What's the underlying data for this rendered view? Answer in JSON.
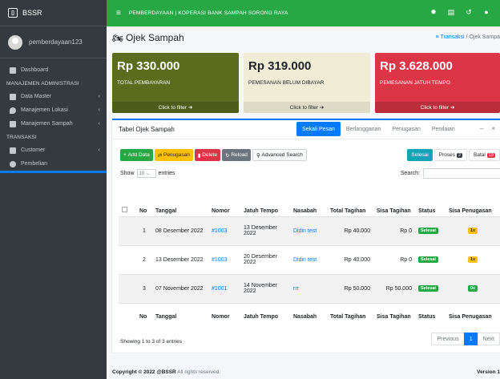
{
  "brand": {
    "name": "BSSR"
  },
  "user": {
    "name": "pemberdayaan123"
  },
  "sidebar": {
    "items": [
      {
        "label": "Dashboard"
      },
      {
        "header": "MANAJEMEN ADMINISTRASI"
      },
      {
        "label": "Data Master"
      },
      {
        "label": "Manajemen Lokasi"
      },
      {
        "label": "Manajemen Sampah"
      },
      {
        "header": "TRANSAKSI"
      },
      {
        "label": "Customer"
      },
      {
        "label": "Pembelian"
      }
    ]
  },
  "topbar": {
    "title": "PEMBERDAYAAN | KOPERASI BANK SAMPAH SORONG RAYA"
  },
  "page": {
    "title": "Ojek Sampah"
  },
  "breadcrumb": {
    "link": "Transaksi",
    "sep": "/",
    "current": "Ojek Sampa"
  },
  "stats": [
    {
      "value": "Rp 330.000",
      "label": "TOTAL PEMBAYARAN",
      "footer": "Click to filter"
    },
    {
      "value": "Rp 319.000",
      "label": "PEMESANAN BELUM DIBAYAR",
      "footer": "Click to filter"
    },
    {
      "value": "Rp 3.628.000",
      "label": "PEMESANAN JATUH TEMPO",
      "footer": "Click to filter"
    }
  ],
  "card": {
    "title": "Tabel Ojek Sampah",
    "tabs": [
      "Sekali Pesan",
      "Berlangganan",
      "Penugasan",
      "Penilaian"
    ],
    "minimize": "–",
    "close": "×"
  },
  "toolbar": {
    "add": "Add Data",
    "assign": "Penugasan",
    "delete": "Delete",
    "reload": "Reload",
    "advanced": "Advanced Search"
  },
  "status_filters": {
    "done": "Selesai",
    "process": "Proses",
    "process_count": "2",
    "cancel": "Batal",
    "cancel_count": "19"
  },
  "show": {
    "prefix": "Show",
    "value": "10",
    "suffix": "entries"
  },
  "search": {
    "label": "Search:"
  },
  "table": {
    "headers": [
      "No",
      "Tanggal",
      "Nomor",
      "Jatuh Tempo",
      "Nasabah",
      "Total Tagihan",
      "Sisa Tagihan",
      "Status",
      "Sisa Penugasan"
    ],
    "rows": [
      {
        "no": "1",
        "tanggal": "08 Desember 2022",
        "nomor": "#1003",
        "jatuh_tempo": "13 Desember 2022",
        "nasabah": "Didin test",
        "total": "Rp 40.000",
        "sisa": "Rp 0",
        "status": "Selesai",
        "sisa_penugasan": "1x"
      },
      {
        "no": "2",
        "tanggal": "13 Desember 2022",
        "nomor": "#1003",
        "jatuh_tempo": "20 Desember 2022",
        "nasabah": "Didin test",
        "total": "Rp 40.000",
        "sisa": "Rp 0",
        "status": "Selesai",
        "sisa_penugasan": "1x"
      },
      {
        "no": "3",
        "tanggal": "07 November 2022",
        "nomor": "#1001",
        "jatuh_tempo": "14 November 2022",
        "nasabah": "rrr",
        "total": "Rp 50.000",
        "sisa": "Rp 50.000",
        "status": "Selesai",
        "sisa_penugasan": "0x"
      }
    ]
  },
  "info": {
    "text": "Showing 1 to 3 of 3 entries"
  },
  "pager": {
    "prev": "Previous",
    "page": "1",
    "next": "Next"
  },
  "footer": {
    "copyright": "Copyright © 2022 @BSSR",
    "rights": "All rights reserved.",
    "version": "Version 1"
  },
  "colors": {
    "topbar": "#28a745",
    "sidebar": "#343a40",
    "primary": "#007bff",
    "danger": "#dc3545",
    "olive": "#5d6b1f"
  }
}
